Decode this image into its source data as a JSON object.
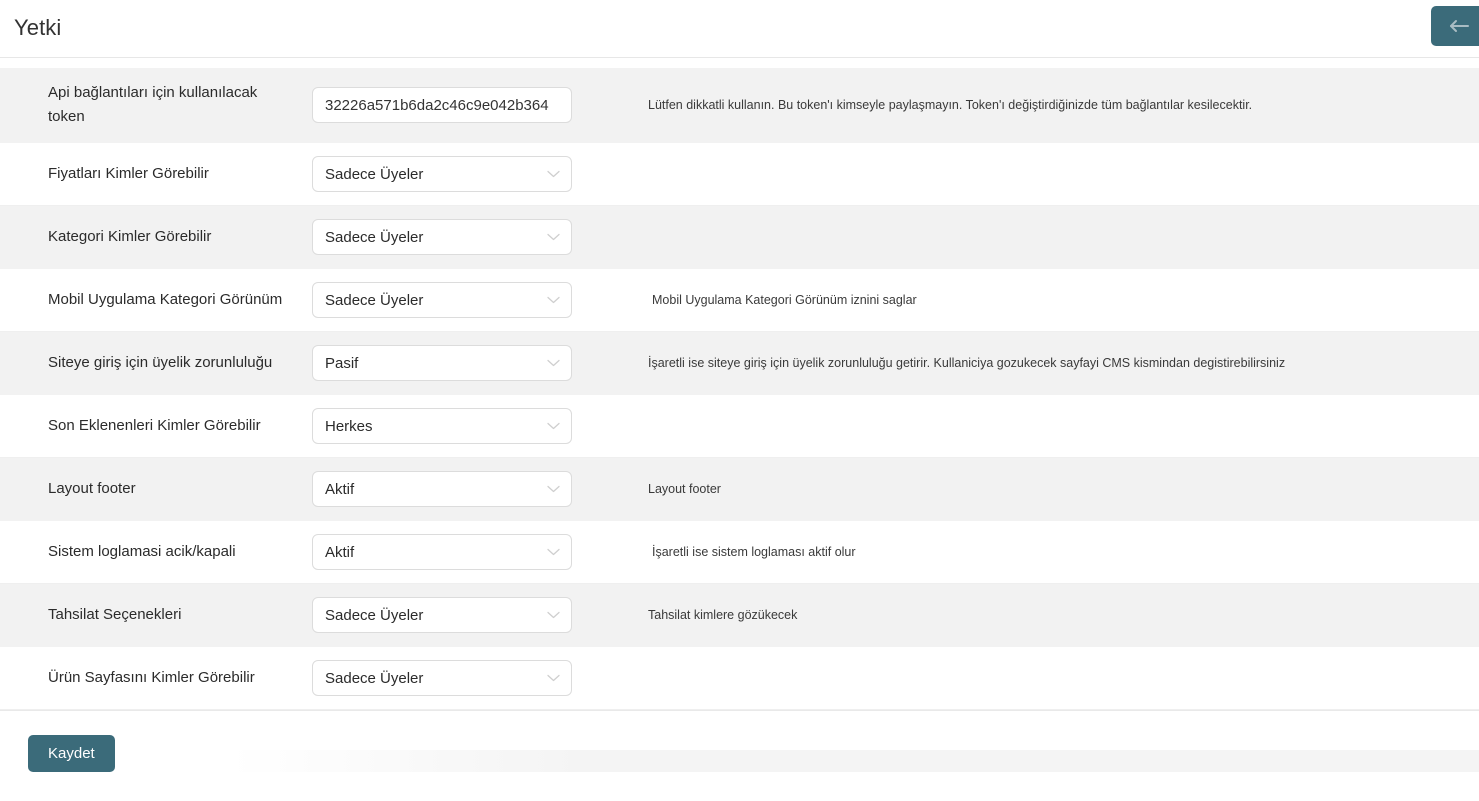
{
  "header": {
    "title": "Yetki",
    "back_button_label": "",
    "back_icon": "arrow-left-icon",
    "accent_color": "#3b6b7a"
  },
  "form": {
    "rows": [
      {
        "label": "Api bağlantıları için kullanılacak token",
        "control": "text",
        "value": "32226a571b6da2c46c9e042b364",
        "placeholder": "",
        "help": "Lütfen dikkatli kullanın. Bu token'ı kimseyle paylaşmayın. Token'ı değiştirdiğinizde tüm bağlantılar kesilecektir.",
        "striped": true
      },
      {
        "label": "Fiyatları Kimler Görebilir",
        "control": "select",
        "value": "Sadece Üyeler",
        "help": "",
        "striped": false
      },
      {
        "label": "Kategori Kimler Görebilir",
        "control": "select",
        "value": "Sadece Üyeler",
        "help": "",
        "striped": true
      },
      {
        "label": "Mobil Uygulama Kategori Görünüm",
        "control": "select",
        "value": "Sadece Üyeler",
        "help": "Mobil Uygulama Kategori Görünüm iznini saglar",
        "striped": false
      },
      {
        "label": "Siteye giriş için üyelik zorunluluğu",
        "control": "select",
        "value": "Pasif",
        "help": "İşaretli ise siteye giriş için üyelik zorunluluğu getirir. Kullaniciya gozukecek sayfayi CMS kismindan degistirebilirsiniz",
        "striped": true
      },
      {
        "label": "Son Eklenenleri Kimler Görebilir",
        "control": "select",
        "value": "Herkes",
        "help": "",
        "striped": false
      },
      {
        "label": "Layout footer",
        "control": "select",
        "value": "Aktif",
        "help": "Layout footer",
        "striped": true
      },
      {
        "label": "Sistem loglamasi acik/kapali",
        "control": "select",
        "value": "Aktif",
        "help": "İşaretli ise sistem loglaması aktif olur",
        "striped": false
      },
      {
        "label": "Tahsilat Seçenekleri",
        "control": "select",
        "value": "Sadece Üyeler",
        "help": "Tahsilat kimlere gözükecek",
        "striped": true
      },
      {
        "label": "Ürün Sayfasını Kimler Görebilir",
        "control": "select",
        "value": "Sadece Üyeler",
        "help": "",
        "striped": false
      }
    ],
    "save_label": "Kaydet"
  }
}
